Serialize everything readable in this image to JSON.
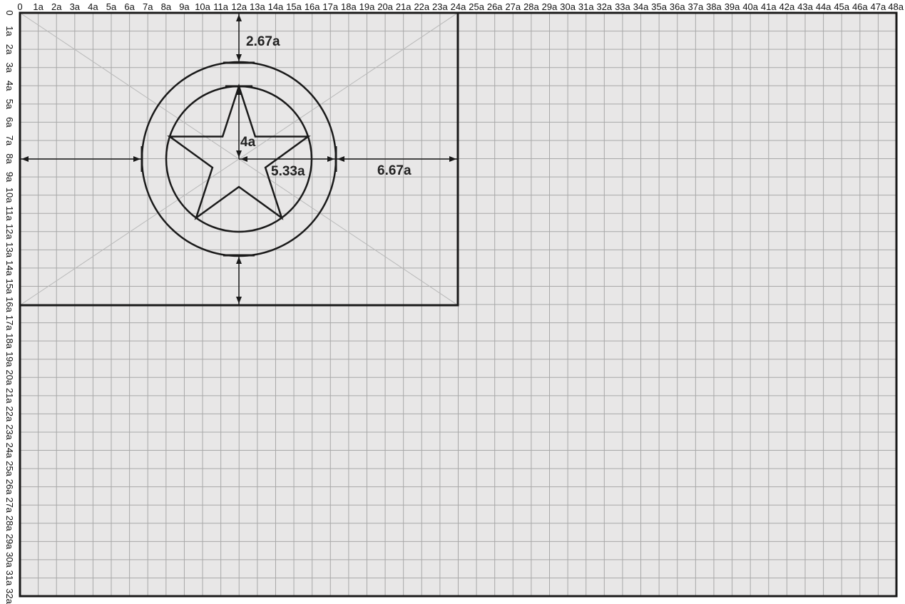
{
  "colors": {
    "background": "#e8e7e7",
    "grid": "#a8a8a8",
    "construction_lines": "#b9b9b9",
    "outline": "#1a1a1a"
  },
  "axes": {
    "top_labels": [
      "0",
      "1a",
      "2a",
      "3a",
      "4a",
      "5a",
      "6a",
      "7a",
      "8a",
      "9a",
      "10a",
      "11a",
      "12a",
      "13a",
      "14a",
      "15a",
      "16a",
      "17a",
      "18a",
      "19a",
      "20a",
      "21a",
      "22a",
      "23a",
      "24a",
      "25a",
      "26a",
      "27a",
      "28a",
      "29a",
      "30a",
      "31a",
      "32a",
      "33a",
      "34a",
      "35a",
      "36a",
      "37a",
      "38a",
      "39a",
      "40a",
      "41a",
      "42a",
      "43a",
      "44a",
      "45a",
      "46a",
      "47a",
      "48a"
    ],
    "left_labels": [
      "0",
      "1a",
      "2a",
      "3a",
      "4a",
      "5a",
      "6a",
      "7a",
      "8a",
      "9a",
      "10a",
      "11a",
      "12a",
      "13a",
      "14a",
      "15a",
      "16a",
      "17a",
      "18a",
      "19a",
      "20a",
      "21a",
      "22a",
      "23a",
      "24a",
      "25a",
      "26a",
      "27a",
      "28a",
      "29a",
      "30a",
      "31a",
      "32a"
    ]
  },
  "dimensions": {
    "top_gap": "2.67a",
    "star_radius": "4a",
    "outer_radius": "5.33a",
    "right_gap": "6.67a"
  }
}
